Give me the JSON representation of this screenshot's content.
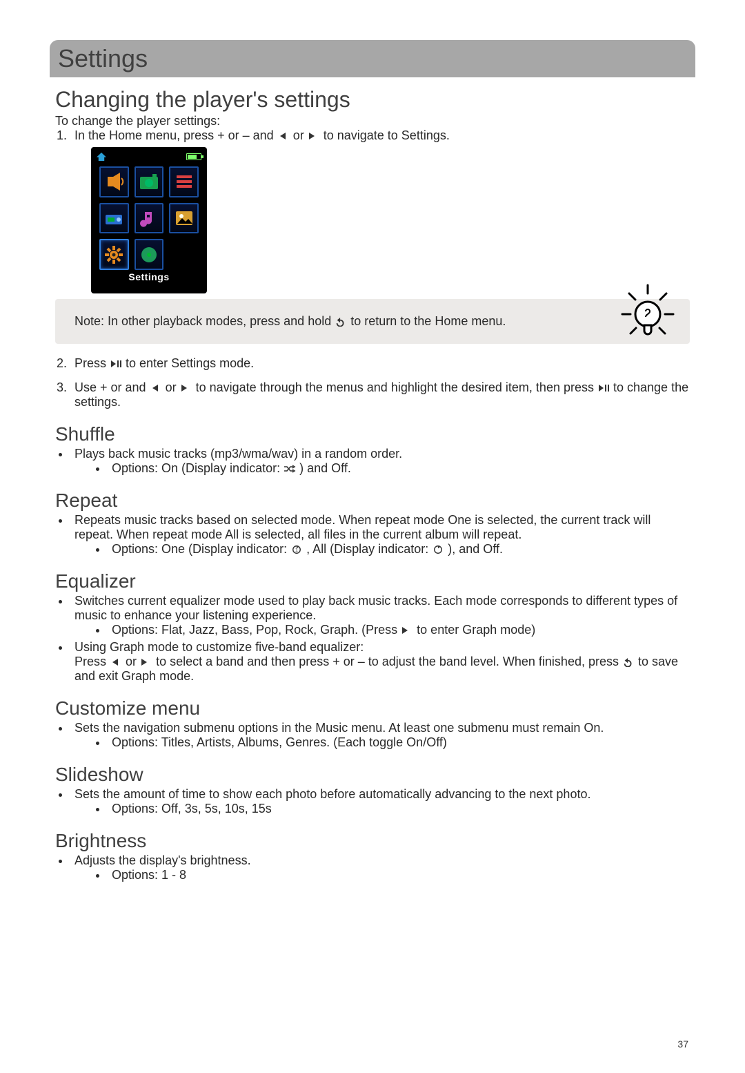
{
  "page_number": "37",
  "title": "Settings",
  "section1": {
    "heading": "Changing the player's settings",
    "intro": "To change the player settings:",
    "step1_a": "In the Home menu, press + or – and ",
    "step1_b": " or ",
    "step1_c": " to navigate to Settings.",
    "device_caption": "Settings",
    "note_prefix": "Note: ",
    "note_body": "In other playback modes, press and hold ",
    "note_tail": " to return to the Home menu.",
    "step2_a": "Press ",
    "step2_b": " to enter Settings mode.",
    "step3_a": "Use  + or   and  ",
    "step3_b": " or ",
    "step3_c": " to navigate through the menus and highlight the desired item, then press ",
    "step3_d": " to change the settings."
  },
  "shuffle": {
    "heading": "Shuffle",
    "b1": "Plays back music tracks (mp3/wma/wav) in a random order.",
    "b2_a": "Options: On (Display indicator:  ",
    "b2_b": " ) and Off."
  },
  "repeat": {
    "heading": "Repeat",
    "b1": "Repeats music tracks based on selected mode. When repeat mode One is selected, the current track will repeat. When repeat mode All is selected, all files in the current album will repeat.",
    "b2_a": "Options: One (Display indicator: ",
    "b2_b": " , All (Display indicator: ",
    "b2_c": " ), and Off."
  },
  "equalizer": {
    "heading": "Equalizer",
    "b1": "Switches current equalizer mode used to play back music tracks. Each mode corresponds to different types of music to enhance your listening experience.",
    "b1s_a": "Options: Flat, Jazz, Bass, Pop, Rock, Graph. (Press ",
    "b1s_b": " to enter Graph mode)",
    "b2": "Using Graph mode to customize five-band equalizer:",
    "b2_body_a": "Press ",
    "b2_body_b": " or ",
    "b2_body_c": "  to select a band and then press + or – to adjust the band level. When finished, press ",
    "b2_body_d": " to save and exit Graph mode."
  },
  "customize": {
    "heading": "Customize menu",
    "b1": "Sets the navigation submenu options in the Music menu. At least one submenu must remain On.",
    "b2": "Options: Titles, Artists, Albums, Genres. (Each toggle On/Off)"
  },
  "slideshow": {
    "heading": "Slideshow",
    "b1": "Sets the amount of time to show each photo before automatically advancing to the next photo.",
    "b2": "Options: Off, 3s, 5s, 10s, 15s"
  },
  "brightness": {
    "heading": "Brightness",
    "b1": "Adjusts the display's brightness.",
    "b2": "Options: 1 - 8"
  },
  "icons": {
    "prev": "previous-track-icon",
    "next": "next-track-icon",
    "playpause": "play-pause-icon",
    "back": "back-return-icon",
    "shuffle": "shuffle-icon",
    "repeat_one": "repeat-one-icon",
    "repeat_all": "repeat-all-icon"
  }
}
